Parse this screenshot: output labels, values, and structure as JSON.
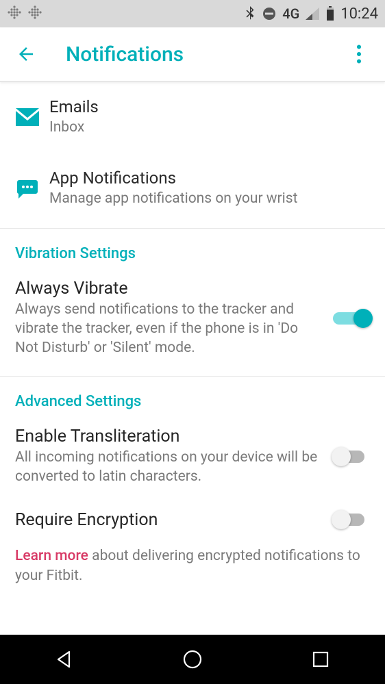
{
  "status_bar": {
    "network_label": "4G",
    "time": "10:24"
  },
  "header": {
    "title": "Notifications"
  },
  "items": {
    "emails": {
      "title": "Emails",
      "sub": "Inbox"
    },
    "app_notifications": {
      "title": "App Notifications",
      "sub": "Manage app notifications on your wrist"
    }
  },
  "sections": {
    "vibration": {
      "header": "Vibration Settings",
      "always_vibrate": {
        "title": "Always Vibrate",
        "sub": "Always send notifications to the tracker and vibrate the tracker, even if the phone is in 'Do Not Disturb' or 'Silent' mode.",
        "enabled": true
      }
    },
    "advanced": {
      "header": "Advanced Settings",
      "transliteration": {
        "title": "Enable Transliteration",
        "sub": "All incoming notifications on your device will be converted to latin characters.",
        "enabled": false
      },
      "encryption": {
        "title": "Require Encryption",
        "enabled": false
      },
      "learn_more": {
        "link": "Learn more",
        "rest": " about delivering encrypted notifications to your Fitbit."
      }
    }
  }
}
